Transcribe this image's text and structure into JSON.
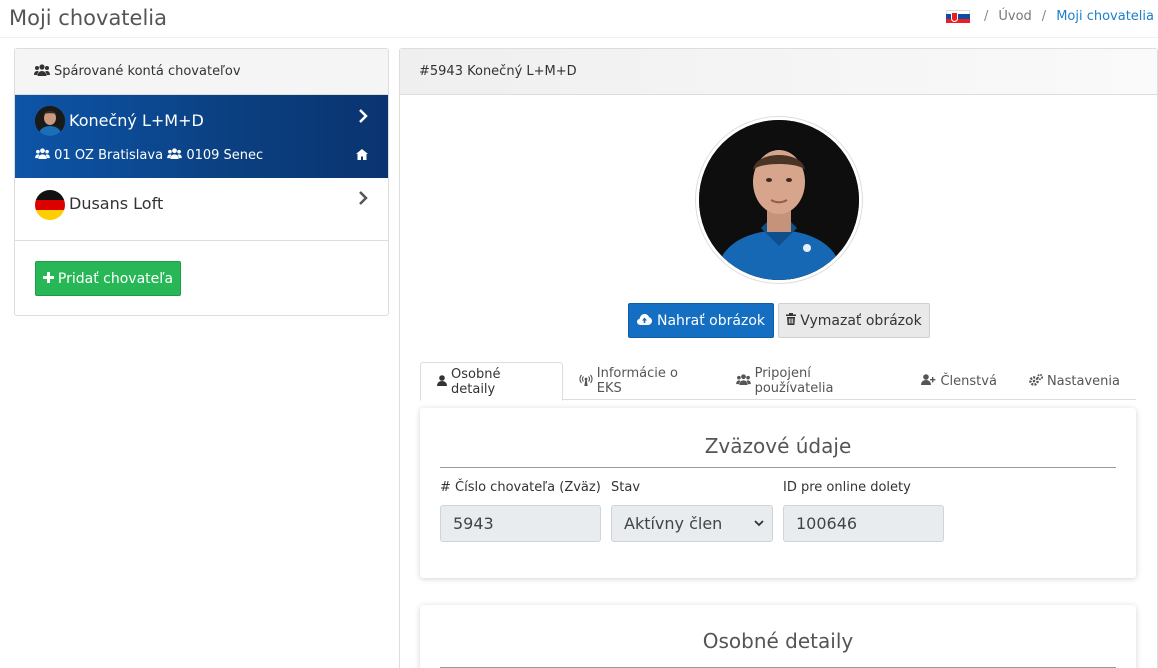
{
  "header": {
    "title": "Moji chovatelia",
    "breadcrumb": {
      "home": "Úvod",
      "separator": "/",
      "current": "Moji chovatelia"
    }
  },
  "sidebar": {
    "heading": "Spárované kontá chovateľov",
    "items": [
      {
        "name": "Konečný L+M+D",
        "club": "01 OZ Bratislava",
        "branch": "0109 Senec",
        "active": true
      },
      {
        "name": "Dusans Loft",
        "active": false
      }
    ],
    "add_button": "Pridať chovateľa"
  },
  "detail": {
    "heading": "#5943 Konečný L+M+D",
    "upload_button": "Nahrať obrázok",
    "delete_button": "Vymazať obrázok",
    "tabs": [
      "Osobné detaily",
      "Informácie o EKS",
      "Pripojení používatelia",
      "Členstvá",
      "Nastavenia"
    ],
    "membership_card": {
      "title": "Zväzové údaje",
      "fields": [
        {
          "label": "# Číslo chovateľa (Zväz)",
          "value": "5943"
        },
        {
          "label": "Stav",
          "value": "Aktívny člen"
        },
        {
          "label": "ID pre online dolety",
          "value": "100646"
        }
      ]
    },
    "personal_card": {
      "title": "Osobné detaily"
    }
  },
  "colors": {
    "active_item": "#0d55a8",
    "add_button": "#28b757",
    "upload_button": "#146ec1",
    "link": "#1c7fc7"
  }
}
